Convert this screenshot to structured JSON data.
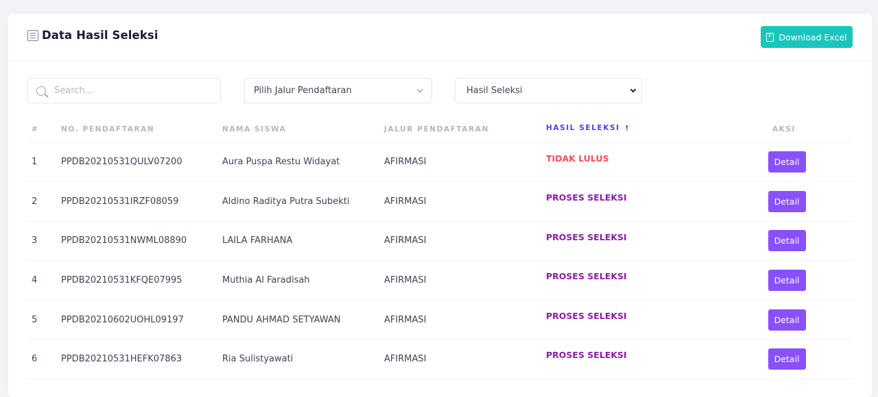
{
  "page": {
    "title": "Data Hasil Seleksi",
    "download_label": "Download Excel"
  },
  "filters": {
    "search_placeholder": "Search...",
    "jalur_selected": "Pilih Jalur Pendaftaran",
    "hasil_selected": "Hasil Seleksi"
  },
  "table": {
    "headers": {
      "index": "#",
      "no_pendaftaran": "NO. PENDAFTARAN",
      "nama_siswa": "NAMA SISWA",
      "jalur": "JALUR PENDAFTARAN",
      "hasil": "HASIL SELEKSI",
      "sort_icon": "arrow-up-icon",
      "aksi": "AKSI"
    },
    "detail_label": "Detail",
    "rows": [
      {
        "no": "1",
        "reg": "PPDB20210531QULV07200",
        "name": "Aura Puspa Restu Widayat",
        "jalur": "AFIRMASI",
        "status": "TIDAK LULUS",
        "action": "Detail"
      },
      {
        "no": "2",
        "reg": "PPDB20210531IRZF08059",
        "name": "Aldino Raditya Putra Subekti",
        "jalur": "AFIRMASI",
        "status": "PROSES SELEKSI",
        "action": "Detail"
      },
      {
        "no": "3",
        "reg": "PPDB20210531NWML08890",
        "name": "LAILA FARHANA",
        "jalur": "AFIRMASI",
        "status": "PROSES SELEKSI",
        "action": "Detail"
      },
      {
        "no": "4",
        "reg": "PPDB20210531KFQE07995",
        "name": "Muthia Al Faradisah",
        "jalur": "AFIRMASI",
        "status": "PROSES SELEKSI",
        "action": "Detail"
      },
      {
        "no": "5",
        "reg": "PPDB20210602UOHL09197",
        "name": "PANDU AHMAD SETYAWAN",
        "jalur": "AFIRMASI",
        "status": "PROSES SELEKSI",
        "action": "Detail"
      },
      {
        "no": "6",
        "reg": "PPDB20210531HEFK07863",
        "name": "Ria Sulistyawati",
        "jalur": "AFIRMASI",
        "status": "PROSES SELEKSI",
        "action": "Detail"
      }
    ]
  },
  "colors": {
    "accent_teal": "#1bc5bd",
    "detail_purple": "#8950fc",
    "status_fail": "#f64e60",
    "status_process": "#8a1ea3",
    "active_header": "#4a3ff5"
  },
  "icons": {
    "title": "list-icon",
    "download": "excel-file-icon",
    "search": "search-icon",
    "jalur_dropdown": "chevron-down-icon",
    "hasil_dropdown": "chevron-down-icon"
  }
}
